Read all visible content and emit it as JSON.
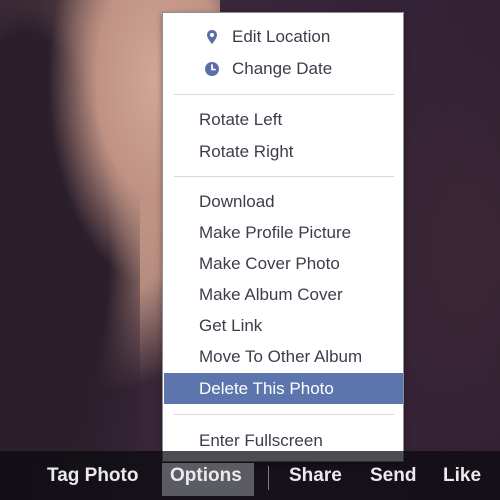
{
  "menu": {
    "items": [
      {
        "label": "Edit Location",
        "icon": "location-pin-icon"
      },
      {
        "label": "Change Date",
        "icon": "clock-icon"
      },
      {
        "label": "Rotate Left"
      },
      {
        "label": "Rotate Right"
      },
      {
        "label": "Download"
      },
      {
        "label": "Make Profile Picture"
      },
      {
        "label": "Make Cover Photo"
      },
      {
        "label": "Make Album Cover"
      },
      {
        "label": "Get Link"
      },
      {
        "label": "Move To Other Album"
      },
      {
        "label": "Delete This Photo",
        "selected": true
      },
      {
        "label": "Enter Fullscreen"
      }
    ],
    "selected_color": "#5c75ac",
    "icon_color": "#5b6fa6"
  },
  "bottom_bar": {
    "tag_photo": "Tag Photo",
    "options": "Options",
    "share": "Share",
    "send": "Send",
    "like": "Like"
  }
}
